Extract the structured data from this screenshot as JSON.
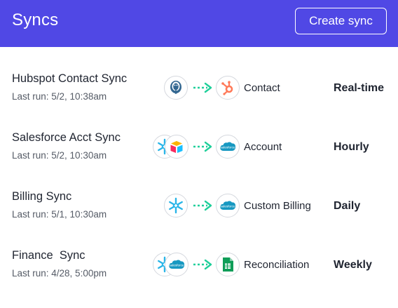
{
  "header": {
    "title": "Syncs",
    "create_button_label": "Create sync",
    "background_color": "#5048e5"
  },
  "syncs": [
    {
      "name": "Hubspot Contact Sync",
      "last_run": "Last run: 5/2, 10:38am",
      "source_icons": [
        "postgresql-icon"
      ],
      "destination_icon": "hubspot-icon",
      "destination_label": "Contact",
      "frequency": "Real-time"
    },
    {
      "name": "Salesforce Acct Sync",
      "last_run": "Last run: 5/2, 10:30am",
      "source_icons": [
        "snowflake-icon",
        "airtable-icon"
      ],
      "destination_icon": "salesforce-icon",
      "destination_label": "Account",
      "frequency": "Hourly"
    },
    {
      "name": "Billing Sync",
      "last_run": "Last run: 5/1, 10:30am",
      "source_icons": [
        "snowflake-icon"
      ],
      "destination_icon": "salesforce-icon",
      "destination_label": "Custom Billing",
      "frequency": "Daily"
    },
    {
      "name": "Finance  Sync",
      "last_run": "Last run: 4/28, 5:00pm",
      "source_icons": [
        "snowflake-icon",
        "salesforce-icon"
      ],
      "destination_icon": "google-sheets-icon",
      "destination_label": "Reconciliation",
      "frequency": "Weekly"
    }
  ],
  "colors": {
    "accent": "#5048e5",
    "arrow": "#1fcf9a",
    "hubspot": "#ff7a59",
    "salesforce": "#1798c1",
    "snowflake": "#29b5e8",
    "sheets": "#0f9d58"
  }
}
